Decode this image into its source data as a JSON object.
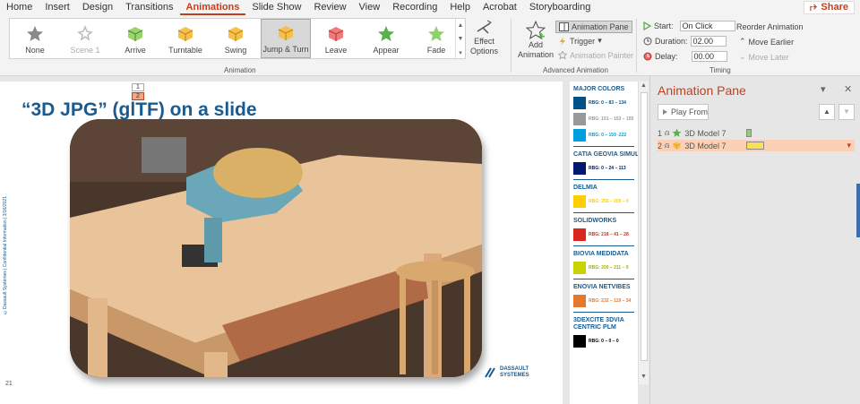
{
  "tabs": [
    "Home",
    "Insert",
    "Design",
    "Transitions",
    "Animations",
    "Slide Show",
    "Review",
    "View",
    "Recording",
    "Help",
    "Acrobat",
    "Storyboarding"
  ],
  "active_tab": "Animations",
  "share_label": "Share",
  "gallery": [
    {
      "label": "None",
      "icon": "star-gray-icon",
      "state": "normal"
    },
    {
      "label": "Scene 1",
      "icon": "scene-icon",
      "state": "disabled"
    },
    {
      "label": "Arrive",
      "icon": "arrive-cube-icon",
      "state": "normal"
    },
    {
      "label": "Turntable",
      "icon": "turntable-cube-icon",
      "state": "normal"
    },
    {
      "label": "Swing",
      "icon": "swing-cube-icon",
      "state": "normal"
    },
    {
      "label": "Jump & Turn",
      "icon": "jump-turn-cube-icon",
      "state": "selected"
    },
    {
      "label": "Leave",
      "icon": "leave-cube-icon",
      "state": "normal"
    },
    {
      "label": "Appear",
      "icon": "appear-star-icon",
      "state": "normal"
    },
    {
      "label": "Fade",
      "icon": "fade-star-icon",
      "state": "normal"
    }
  ],
  "effect_options": [
    "Effect",
    "Options"
  ],
  "group_animation": "Animation",
  "add_animation": [
    "Add",
    "Animation"
  ],
  "animation_pane_btn": "Animation Pane",
  "trigger_btn": "Trigger",
  "animation_painter_btn": "Animation Painter",
  "group_advanced": "Advanced Animation",
  "start_label": "Start:",
  "start_value": "On Click",
  "duration_label": "Duration:",
  "duration_value": "02.00",
  "delay_label": "Delay:",
  "delay_value": "00.00",
  "reorder_label": "Reorder Animation",
  "move_earlier": "Move Earlier",
  "move_later": "Move Later",
  "group_timing": "Timing",
  "slide": {
    "title": "“3D JPG” (glTF) on a slide",
    "tags": [
      "1",
      "2"
    ],
    "side_text": "©Dassault Systèmes | Confidential Information | 3/16/2021",
    "page_number": "21",
    "logo_line1": "DASSAULT",
    "logo_line2": "SYSTEMES"
  },
  "colors": [
    {
      "heading": "MAJOR COLORS",
      "items": [
        {
          "color": "#005386",
          "value": "RBG: 0 – 83 – 134"
        },
        {
          "color": "#97999b",
          "value": "RBG: 151 – 153 – 155"
        },
        {
          "color": "#009fde",
          "value": "RBG: 0 – 159 -222"
        }
      ]
    },
    {
      "heading": "CATIA GEOVIA SIMULIA",
      "items": [
        {
          "color": "#001871",
          "value": "RBG: 0 – 24 – 113"
        }
      ]
    },
    {
      "heading": "DELMIA",
      "items": [
        {
          "color": "#ffcd00",
          "value": "RBG: 255 – 205 – 0"
        }
      ]
    },
    {
      "heading": "SOLIDWORKS",
      "items": [
        {
          "color": "#da291c",
          "value": "RBG: 218 – 41 – 28"
        }
      ]
    },
    {
      "heading": "BIOVIA MEDIDATA",
      "items": [
        {
          "color": "#c8d300",
          "value": "RBG: 200 – 211 – 0"
        }
      ]
    },
    {
      "heading": "ENOVIA NETVIBES",
      "items": [
        {
          "color": "#e8772e",
          "value": "RBG: 232 – 119 – 34"
        }
      ]
    },
    {
      "heading": "3DEXCITE 3DVIA CENTRIC PLM",
      "items": [
        {
          "color": "#000000",
          "value": "RBG: 0 – 0 – 0"
        }
      ]
    }
  ],
  "pane": {
    "title": "Animation Pane",
    "play_from": "Play From",
    "rows": [
      {
        "num": "1",
        "name": "3D Model 7",
        "icon": "appear-star-icon",
        "bar_color": "#8fd16b"
      },
      {
        "num": "2",
        "name": "3D Model 7",
        "icon": "jump-turn-cube-icon",
        "bar_color": "#f7e05b"
      }
    ]
  }
}
